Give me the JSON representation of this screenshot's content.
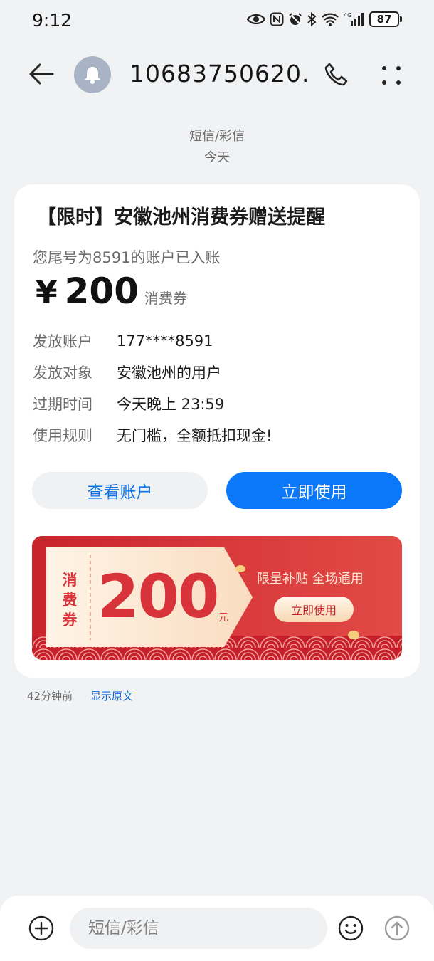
{
  "status_bar": {
    "time": "9:12",
    "network": "4G",
    "battery": "87"
  },
  "header": {
    "contact": "10683750620...",
    "icons": [
      "back-arrow-icon",
      "bell-avatar-icon",
      "phone-icon",
      "more-dots-icon"
    ]
  },
  "thread": {
    "type_label": "短信/彩信",
    "date_label": "今天"
  },
  "card": {
    "title": "【限时】安徽池州消费券赠送提醒",
    "subtitle": "您尾号为8591的账户已入账",
    "amount_currency": "¥",
    "amount_value": "200",
    "amount_unit": "消费券",
    "rows": [
      {
        "label": "发放账户",
        "value": "177****8591"
      },
      {
        "label": "发放对象",
        "value": "安徽池州的用户"
      },
      {
        "label": "过期时间",
        "value": "今天晚上 23:59"
      },
      {
        "label": "使用规则",
        "value": "无门槛，全额抵扣现金!"
      }
    ],
    "btn_view": "查看账户",
    "btn_use": "立即使用",
    "colors": {
      "primary": "#0a78f8",
      "link": "#0d72e6"
    }
  },
  "banner": {
    "ticket_label": "消费券",
    "ticket_value": "200",
    "ticket_unit": "元",
    "slogan": "限量补贴 全场通用",
    "button": "立即使用",
    "colors": {
      "red": "#d8323a",
      "gold": "#f7d7b4"
    }
  },
  "message_meta": {
    "time": "42分钟前",
    "show_original": "显示原文"
  },
  "composer": {
    "placeholder": "短信/彩信",
    "icons": [
      "add-icon",
      "emoji-icon",
      "send-arrow-icon"
    ]
  }
}
